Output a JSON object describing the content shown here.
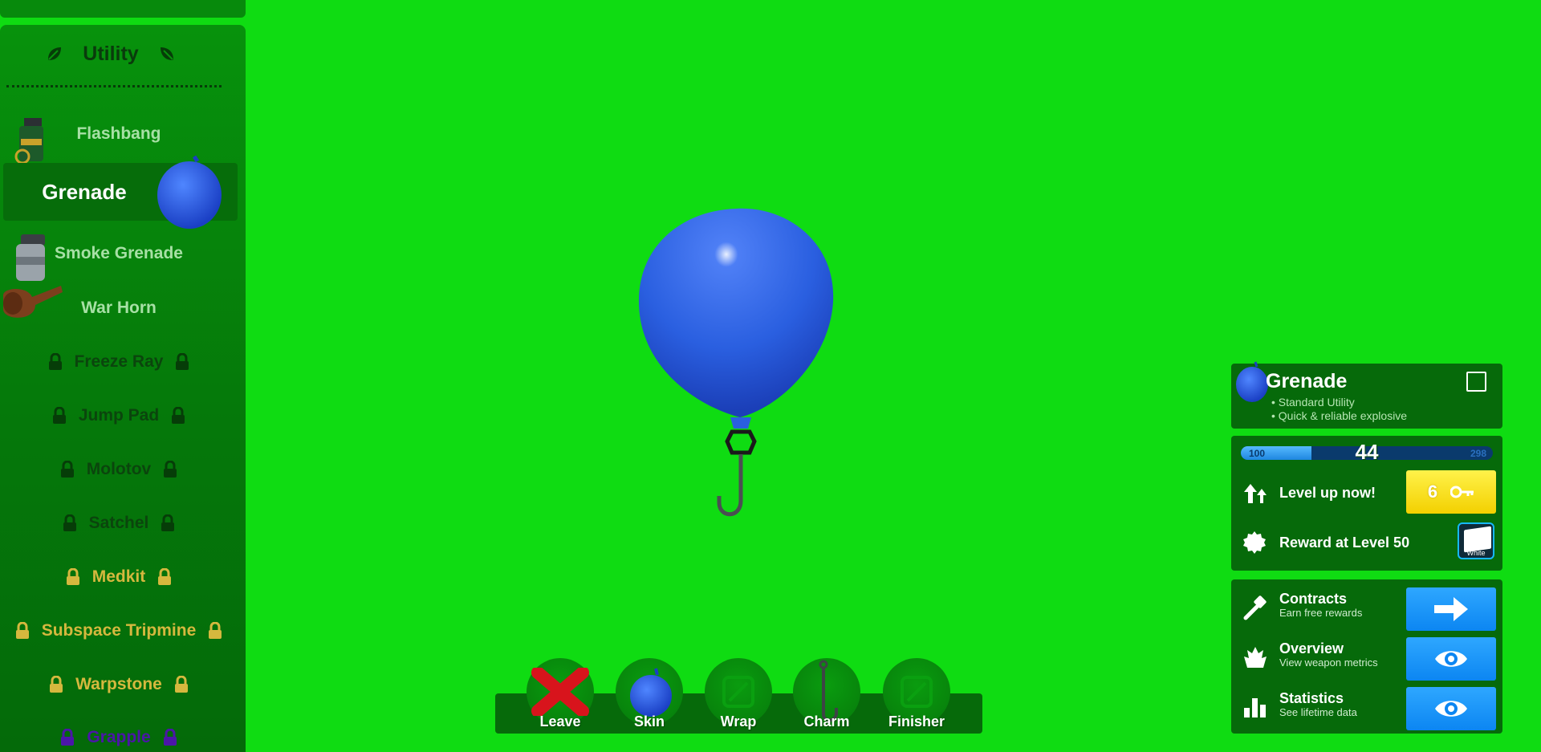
{
  "sidebar": {
    "header": "Utility",
    "items": [
      {
        "label": "Flashbang",
        "state": "unlocked"
      },
      {
        "label": "Grenade",
        "state": "selected"
      },
      {
        "label": "Smoke Grenade",
        "state": "unlocked"
      },
      {
        "label": "War Horn",
        "state": "unlocked"
      },
      {
        "label": "Freeze Ray",
        "state": "locked"
      },
      {
        "label": "Jump Pad",
        "state": "locked"
      },
      {
        "label": "Molotov",
        "state": "locked"
      },
      {
        "label": "Satchel",
        "state": "locked"
      },
      {
        "label": "Medkit",
        "state": "locked-gold"
      },
      {
        "label": "Subspace Tripmine",
        "state": "locked-gold"
      },
      {
        "label": "Warpstone",
        "state": "locked-gold"
      },
      {
        "label": "Grapple",
        "state": "locked-purple"
      }
    ]
  },
  "toolbar": {
    "leave": "Leave",
    "skin": "Skin",
    "wrap": "Wrap",
    "charm": "Charm",
    "finisher": "Finisher"
  },
  "weapon_card": {
    "name": "Grenade",
    "bullets": [
      "• Standard Utility",
      "• Quick & reliable explosive"
    ]
  },
  "progress": {
    "level": "44",
    "min_label": "100",
    "max_label": "298",
    "fill_fraction": 0.28,
    "level_up_label": "Level up now!",
    "key_cost": "6",
    "reward_label": "Reward at Level 50",
    "reward_tag": "White"
  },
  "menu": {
    "contracts_title": "Contracts",
    "contracts_sub": "Earn free rewards",
    "overview_title": "Overview",
    "overview_sub": "View weapon metrics",
    "statistics_title": "Statistics",
    "statistics_sub": "See lifetime data"
  },
  "colors": {
    "background": "#0fdc12",
    "balloon": "#2a5fe0",
    "accent_blue": "#0c86f2",
    "key_yellow": "#f3d000"
  }
}
